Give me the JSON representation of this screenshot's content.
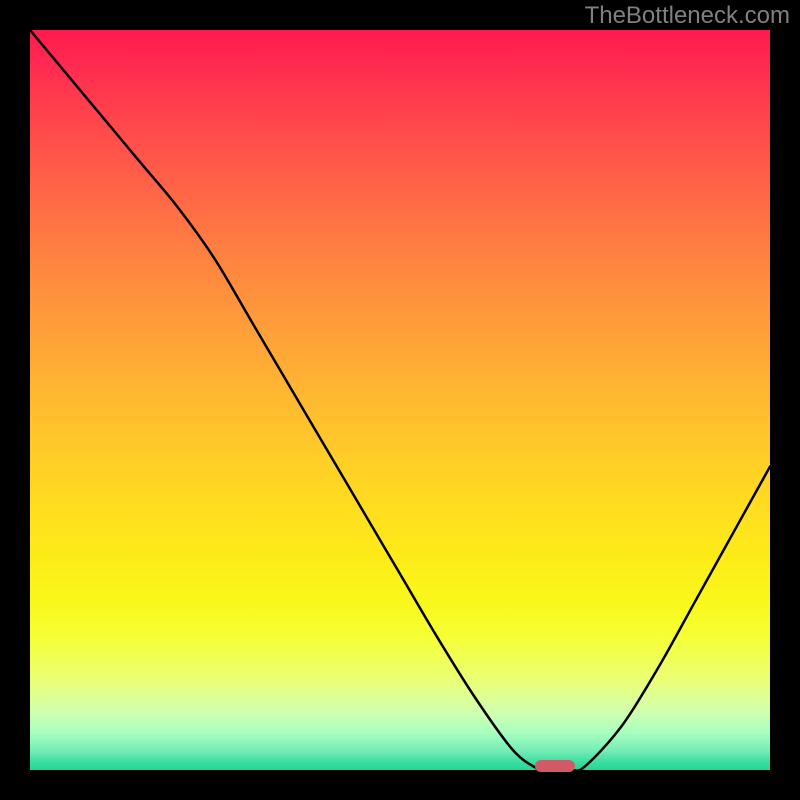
{
  "watermark": "TheBottleneck.com",
  "chart_data": {
    "type": "line",
    "title": "",
    "xlabel": "",
    "ylabel": "",
    "xlim": [
      0,
      100
    ],
    "ylim": [
      0,
      100
    ],
    "x": [
      0,
      5,
      10,
      15,
      20,
      25,
      30,
      35,
      40,
      45,
      50,
      55,
      60,
      65,
      68,
      70,
      73,
      75,
      80,
      85,
      90,
      95,
      100
    ],
    "values": [
      100,
      94,
      88,
      82,
      76,
      69,
      60.5,
      52,
      43.5,
      35,
      26.5,
      18,
      10,
      3,
      0.5,
      0,
      0,
      0.5,
      6,
      14,
      23,
      32,
      41
    ],
    "marker_x": 71,
    "gradient": {
      "top_color": "#ff1a4d",
      "mid_color": "#ffdc20",
      "bottom_color": "#24d796"
    }
  }
}
